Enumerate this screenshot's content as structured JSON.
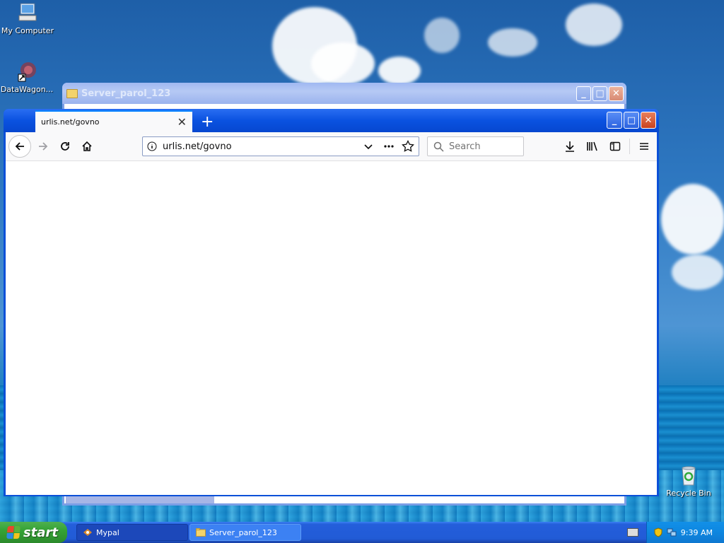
{
  "desktop": {
    "icons": [
      {
        "label": "My Computer"
      },
      {
        "label": "DataWagon..."
      },
      {
        "label": "Recycle Bin"
      }
    ]
  },
  "explorer_window": {
    "title": "Server_parol_123"
  },
  "browser": {
    "tab_title": "urlis.net/govno",
    "url": "urlis.net/govno",
    "search_placeholder": "Search"
  },
  "taskbar": {
    "start_label": "start",
    "tasks": [
      {
        "label": "Mypal"
      },
      {
        "label": "Server_parol_123"
      }
    ],
    "clock": "9:39 AM"
  },
  "colors": {
    "titlebar_blue": "#0a52e0",
    "taskbar_blue": "#245edb",
    "start_green": "#35a335"
  }
}
